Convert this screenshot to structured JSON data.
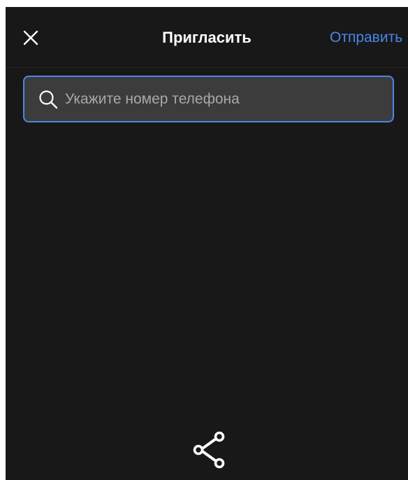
{
  "header": {
    "title": "Пригласить",
    "send_label": "Отправить",
    "close_icon": "close-icon"
  },
  "search": {
    "placeholder": "Укажите номер телефона",
    "value": "",
    "icon": "search-icon"
  },
  "footer": {
    "share_icon": "share-icon"
  },
  "colors": {
    "background": "#181818",
    "accent": "#4a86e8",
    "input_bg": "#3c3c3c",
    "text": "#ffffff",
    "placeholder": "#a8a8a8"
  }
}
